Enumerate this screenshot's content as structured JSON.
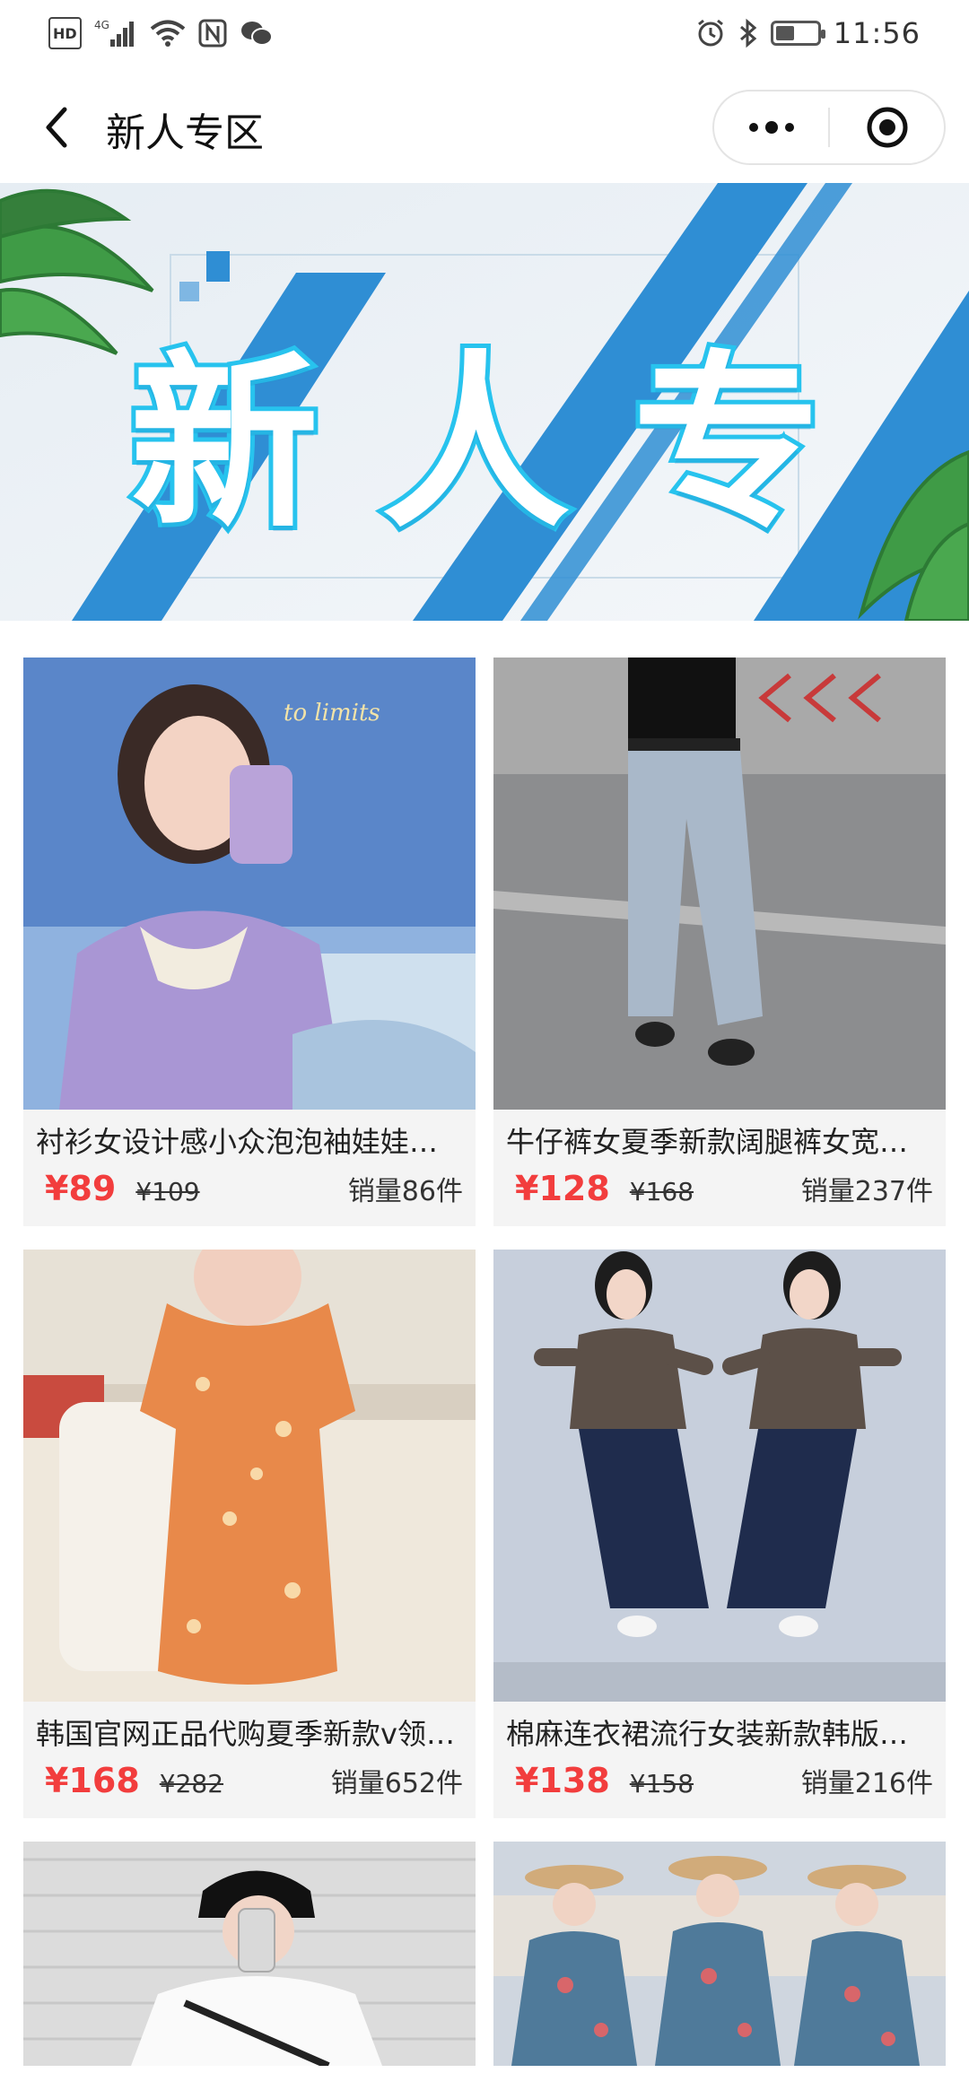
{
  "status_bar": {
    "left_icons": [
      "hd-icon",
      "signal-4g-icon",
      "wifi-icon",
      "nfc-icon",
      "wechat-icon"
    ],
    "hd_label": "HD",
    "net_label": "4G",
    "right_icons": [
      "alarm-icon",
      "bluetooth-icon",
      "battery-icon"
    ],
    "battery_level": 0.4,
    "time": "11:56"
  },
  "nav": {
    "title": "新人专区",
    "back_icon": "chevron-left-icon",
    "more_icon": "more-dots-icon",
    "close_icon": "target-circle-icon"
  },
  "banner": {
    "title": "新人专区",
    "accent": "#27c3ee",
    "stripe_color": "#2f8ed4"
  },
  "products": [
    {
      "title": "衬衫女设计感小众泡泡袖娃娃…",
      "price": "¥89",
      "original_price": "¥109",
      "sales": "销量86件",
      "image": "girl-lavender-blouse-photo"
    },
    {
      "title": "牛仔裤女夏季新款阔腿裤女宽…",
      "price": "¥128",
      "original_price": "¥168",
      "sales": "销量237件",
      "image": "wide-leg-jeans-photo"
    },
    {
      "title": "韩国官网正品代购夏季新款v领…",
      "price": "¥168",
      "original_price": "¥282",
      "sales": "销量652件",
      "image": "floral-dress-photo"
    },
    {
      "title": "棉麻连衣裙流行女装新款韩版…",
      "price": "¥138",
      "original_price": "¥158",
      "sales": "销量216件",
      "image": "linen-two-piece-photo"
    },
    {
      "title": "",
      "price": "",
      "original_price": "",
      "sales": "",
      "image": "white-shirt-cap-photo"
    },
    {
      "title": "",
      "price": "",
      "original_price": "",
      "sales": "",
      "image": "floral-maxi-dress-photo"
    }
  ],
  "colors": {
    "price_red": "#f23d3d",
    "card_bg": "#f4f4f4"
  }
}
